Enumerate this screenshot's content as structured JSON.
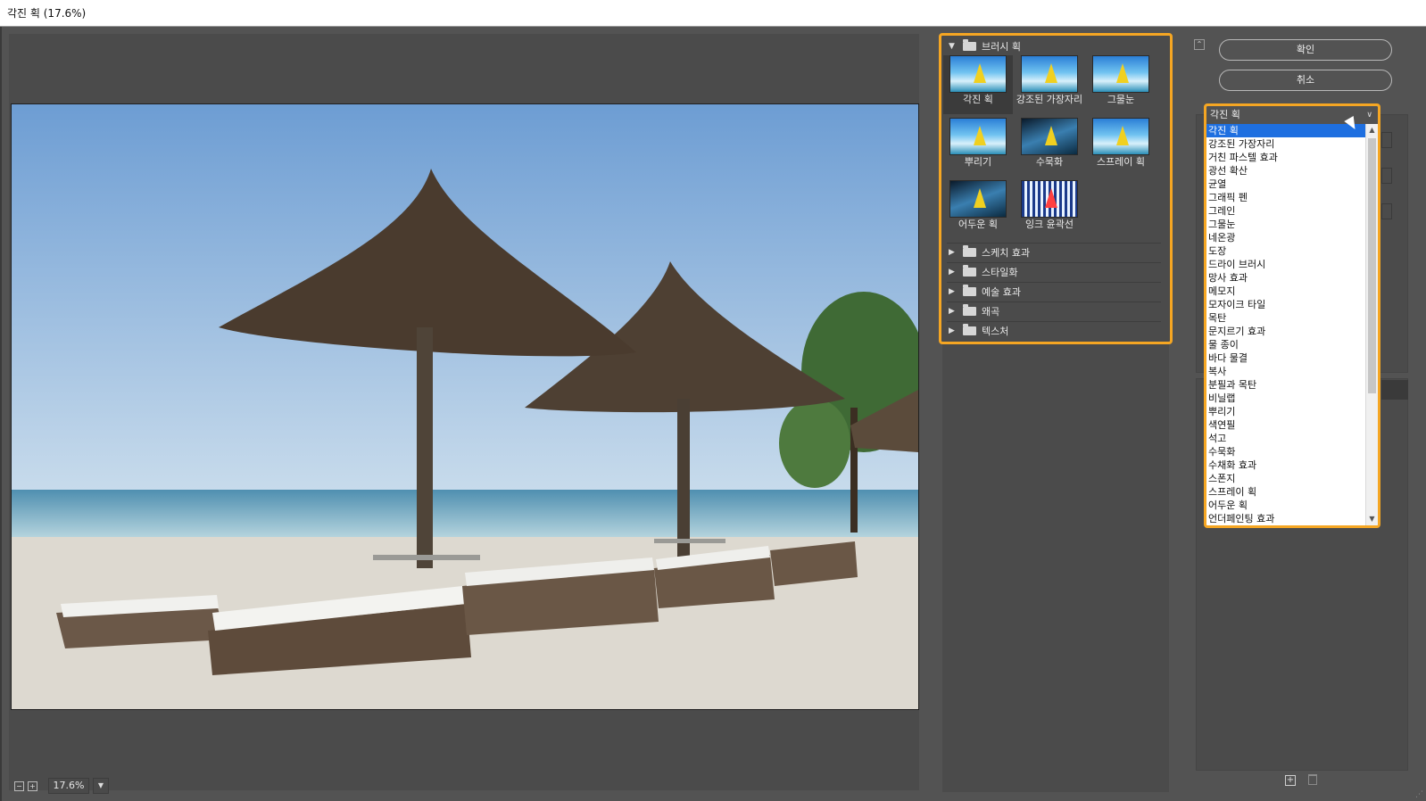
{
  "window": {
    "title": "각진 획 (17.6%)"
  },
  "preview": {
    "zoom_value": "17.6%"
  },
  "gallery": {
    "open_category": "브러시 획",
    "thumbnails": [
      {
        "label": "각진 획",
        "selected": true,
        "style": "normal"
      },
      {
        "label": "강조된 가장자리",
        "selected": false,
        "style": "normal"
      },
      {
        "label": "그물눈",
        "selected": false,
        "style": "normal"
      },
      {
        "label": "뿌리기",
        "selected": false,
        "style": "normal"
      },
      {
        "label": "수묵화",
        "selected": false,
        "style": "dark"
      },
      {
        "label": "스프레이 획",
        "selected": false,
        "style": "normal"
      },
      {
        "label": "어두운 획",
        "selected": false,
        "style": "dark"
      },
      {
        "label": "잉크 윤곽선",
        "selected": false,
        "style": "ink"
      }
    ],
    "categories": [
      "스케치 효과",
      "스타일화",
      "예술 효과",
      "왜곡",
      "텍스처"
    ]
  },
  "buttons": {
    "ok": "확인",
    "cancel": "취소"
  },
  "filter_dropdown": {
    "selected": "각진 획",
    "options": [
      "각진 획",
      "강조된 가장자리",
      "거친 파스텔 효과",
      "광선 확산",
      "균열",
      "그래픽 펜",
      "그레인",
      "그물눈",
      "네온광",
      "도장",
      "드라이 브러시",
      "망사 효과",
      "메모지",
      "모자이크 타일",
      "목탄",
      "문지르기 효과",
      "물 종이",
      "바다 물결",
      "복사",
      "분필과 목탄",
      "비닐랩",
      "뿌리기",
      "색연필",
      "석고",
      "수묵화",
      "수채화 효과",
      "스폰지",
      "스프레이 획",
      "어두운 획",
      "언더페인팅 효과"
    ]
  },
  "colors": {
    "accent_outline": "#f5a623",
    "list_highlight": "#1e6fe0",
    "panel_bg": "#535353"
  }
}
